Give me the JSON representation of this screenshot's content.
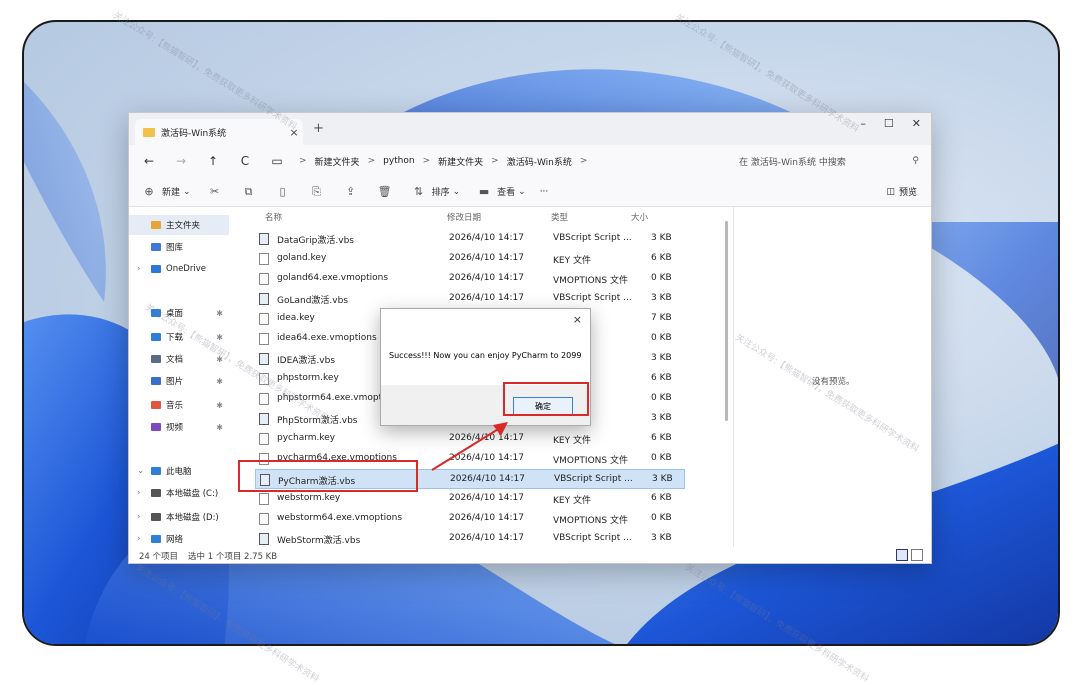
{
  "window": {
    "tab_title": "激活码-Win系统",
    "tab_close": "×",
    "new_tab": "+",
    "controls": [
      "–",
      "☐",
      "✕"
    ]
  },
  "address": {
    "back": "←",
    "forward": "→",
    "up": "↑",
    "refresh": "C",
    "breadcrumbs": [
      "新建文件夹",
      "python",
      "新建文件夹",
      "激活码-Win系统"
    ],
    "separator": ">",
    "search_placeholder": "在 激活码-Win系统 中搜索",
    "search_icon": "⚲"
  },
  "toolbar": {
    "new_label": "新建",
    "sort_label": "排序",
    "view_label": "查看",
    "more": "···",
    "preview_label": "预览"
  },
  "sidebar": {
    "items": [
      {
        "label": "主文件夹",
        "color": "#e9a33b",
        "pin": ""
      },
      {
        "label": "图库",
        "color": "#3e7ad6",
        "pin": ""
      },
      {
        "label": "OneDrive",
        "color": "#2b78d6",
        "pin": ""
      },
      {
        "label": "桌面",
        "color": "#2f7fd8",
        "pin": "✱"
      },
      {
        "label": "下载",
        "color": "#2f7fd8",
        "pin": "✱"
      },
      {
        "label": "文档",
        "color": "#5a6b85",
        "pin": "✱"
      },
      {
        "label": "图片",
        "color": "#3a6fc9",
        "pin": "✱"
      },
      {
        "label": "音乐",
        "color": "#e0553d",
        "pin": "✱"
      },
      {
        "label": "视频",
        "color": "#7d48c2",
        "pin": "✱"
      },
      {
        "label": "此电脑",
        "color": "#2f7fd8",
        "pin": ""
      },
      {
        "label": "本地磁盘 (C:)",
        "color": "#555555",
        "pin": ""
      },
      {
        "label": "本地磁盘 (D:)",
        "color": "#555555",
        "pin": ""
      },
      {
        "label": "网络",
        "color": "#2f7fd8",
        "pin": ""
      }
    ]
  },
  "columns": {
    "name": "名称",
    "date": "修改日期",
    "type": "类型",
    "size": "大小"
  },
  "files": [
    {
      "name": "DataGrip激活.vbs",
      "date": "2026/4/10 14:17",
      "type": "VBScript Script ...",
      "size": "3 KB",
      "kind": "vbs"
    },
    {
      "name": "goland.key",
      "date": "2026/4/10 14:17",
      "type": "KEY 文件",
      "size": "6 KB",
      "kind": "file"
    },
    {
      "name": "goland64.exe.vmoptions",
      "date": "2026/4/10 14:17",
      "type": "VMOPTIONS 文件",
      "size": "0 KB",
      "kind": "file"
    },
    {
      "name": "GoLand激活.vbs",
      "date": "2026/4/10 14:17",
      "type": "VBScript Script ...",
      "size": "3 KB",
      "kind": "vbs"
    },
    {
      "name": "idea.key",
      "date": "",
      "type": "",
      "size": "7 KB",
      "kind": "file"
    },
    {
      "name": "idea64.exe.vmoptions",
      "date": "",
      "type": "文件",
      "size": "0 KB",
      "kind": "file"
    },
    {
      "name": "IDEA激活.vbs",
      "date": "",
      "type": "ript ...",
      "size": "3 KB",
      "kind": "vbs"
    },
    {
      "name": "phpstorm.key",
      "date": "",
      "type": "",
      "size": "6 KB",
      "kind": "file"
    },
    {
      "name": "phpstorm64.exe.vmoptions",
      "date": "",
      "type": "文件",
      "size": "0 KB",
      "kind": "file"
    },
    {
      "name": "PhpStorm激活.vbs",
      "date": "",
      "type": "ript ...",
      "size": "3 KB",
      "kind": "vbs"
    },
    {
      "name": "pycharm.key",
      "date": "2026/4/10 14:17",
      "type": "KEY 文件",
      "size": "6 KB",
      "kind": "file"
    },
    {
      "name": "pycharm64.exe.vmoptions",
      "date": "2026/4/10 14:17",
      "type": "VMOPTIONS 文件",
      "size": "0 KB",
      "kind": "file"
    },
    {
      "name": "PyCharm激活.vbs",
      "date": "2026/4/10 14:17",
      "type": "VBScript Script ...",
      "size": "3 KB",
      "kind": "vbs",
      "selected": true
    },
    {
      "name": "webstorm.key",
      "date": "2026/4/10 14:17",
      "type": "KEY 文件",
      "size": "6 KB",
      "kind": "file"
    },
    {
      "name": "webstorm64.exe.vmoptions",
      "date": "2026/4/10 14:17",
      "type": "VMOPTIONS 文件",
      "size": "0 KB",
      "kind": "file"
    },
    {
      "name": "WebStorm激活.vbs",
      "date": "2026/4/10 14:17",
      "type": "VBScript Script ...",
      "size": "3 KB",
      "kind": "vbs"
    }
  ],
  "details_empty": "没有预览。",
  "status": {
    "count": "24 个项目",
    "selected": "选中 1 个项目 2.75 KB"
  },
  "dialog": {
    "close": "×",
    "message": "Success!!! Now you can enjoy PyCharm to 2099",
    "ok_label": "确定"
  },
  "watermark": "关注公众号:【熊猫智研】，免费获取更多科研学术资料",
  "colors": {
    "accent": "#3c7fd6",
    "highlight_box": "#d92a2a",
    "selection": "#cfe2f6"
  }
}
